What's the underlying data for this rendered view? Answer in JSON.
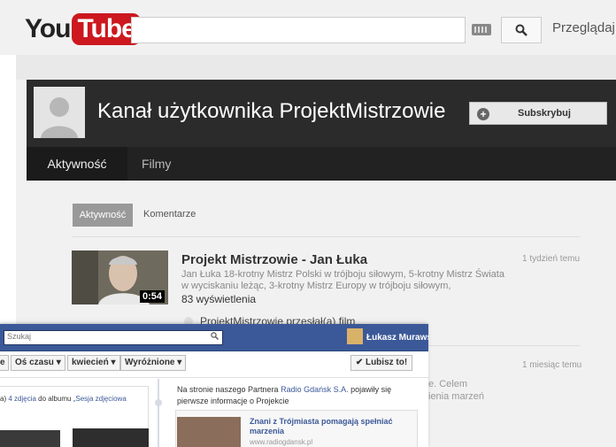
{
  "youtube": {
    "logo_you": "You",
    "logo_tube": "Tube",
    "browse": "Przeglądaj",
    "channel_title": "Kanał użytkownika ProjektMistrzowie",
    "subscribe": "Subskrybuj",
    "tabs": [
      "Aktywność",
      "Filmy"
    ],
    "subtabs": [
      "Aktywność",
      "Komentarze"
    ],
    "video": {
      "title": "Projekt Mistrzowie - Jan Łuka",
      "description": "Jan Łuka 18-krotny Mistrz Polski w trójboju siłowym, 5-krotny Mistrz Świata w wyciskaniu leżąc, 3-krotny Mistrz Europy w trójboju siłowym,",
      "views": "83 wyświetlenia",
      "duration": "0:54",
      "time": "1 tydzień temu",
      "uploader": "ProjektMistrzowie przesłał(a) film"
    },
    "item2": {
      "time": "1 miesiąc temu",
      "desc_line1": "e. Celem",
      "desc_line2": "ienia marzeń"
    }
  },
  "facebook": {
    "search_placeholder": "Szukaj",
    "user_name": "Łukasz Murawski",
    "nav": {
      "e": "e",
      "timeline": "Oś czasu",
      "month": "kwiecień",
      "highlights": "Wyróżnione",
      "like": "✔ Lubisz to!"
    },
    "left_text_a": "a) ",
    "left_text_link1": "4 zdjęcia",
    "left_text_b": " do albumu ",
    "left_text_link2": "„Sesja zdjęciowa",
    "right_text_a": "Na stronie naszego Partnera ",
    "right_text_link": "Radio Gdańsk S.A.",
    "right_text_b": " pojawiły się pierwsze informacje o Projekcie",
    "link_title": "Znani z Trójmiasta pomagają spełniać marzenia",
    "link_url": "www.radiogdansk.pl"
  }
}
